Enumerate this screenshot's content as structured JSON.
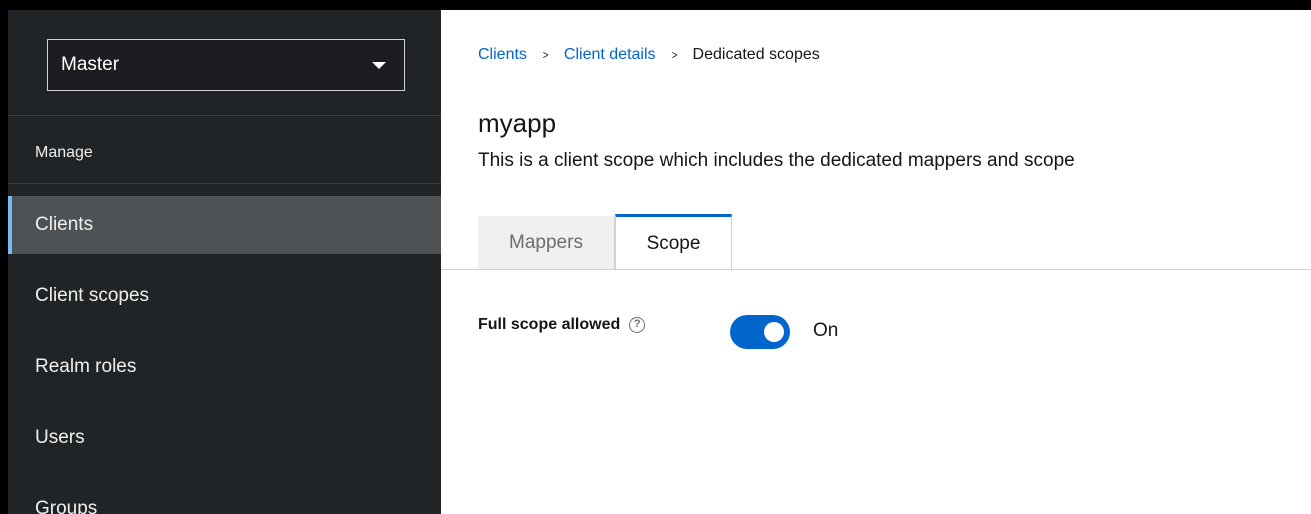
{
  "sidebar": {
    "realm_selector": {
      "value": "Master"
    },
    "section_title": "Manage",
    "items": [
      {
        "label": "Clients",
        "active": true
      },
      {
        "label": "Client scopes",
        "active": false
      },
      {
        "label": "Realm roles",
        "active": false
      },
      {
        "label": "Users",
        "active": false
      },
      {
        "label": "Groups",
        "active": false
      }
    ]
  },
  "breadcrumb": {
    "items": [
      "Clients",
      "Client details",
      "Dedicated scopes"
    ],
    "separator": ">"
  },
  "page": {
    "title": "myapp",
    "description": "This is a client scope which includes the dedicated mappers and scope"
  },
  "tabs": [
    {
      "label": "Mappers",
      "selected": false
    },
    {
      "label": "Scope",
      "selected": true
    }
  ],
  "form": {
    "full_scope": {
      "label": "Full scope allowed",
      "help_icon": "?",
      "toggle_state": "On",
      "enabled": true
    }
  },
  "colors": {
    "sidebar_bg": "#212427",
    "active_item_bg": "#4f5255",
    "accent": "#0066cc",
    "active_indicator": "#73bcf7"
  }
}
